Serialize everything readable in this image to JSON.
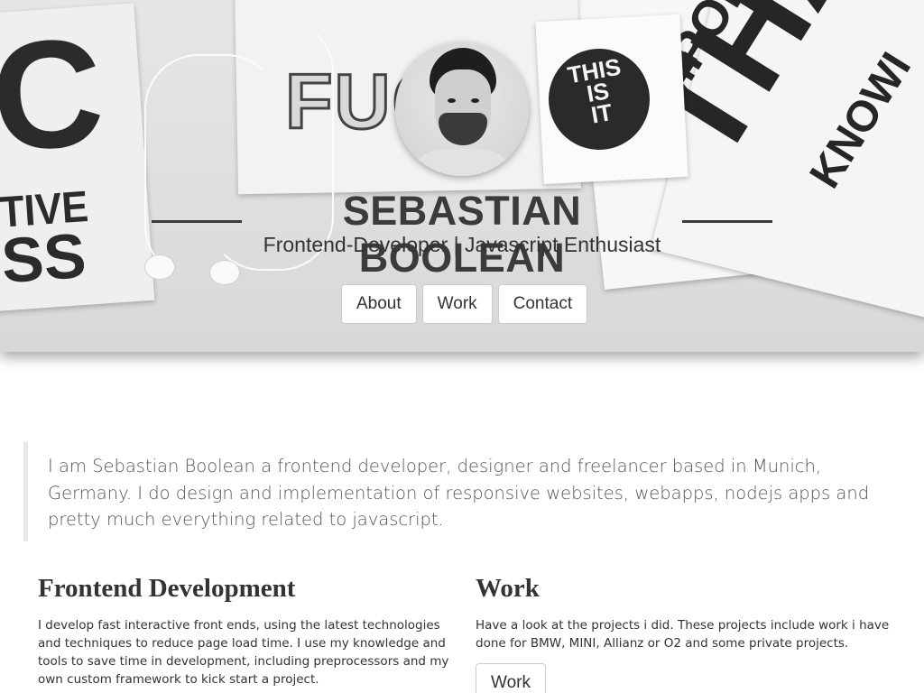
{
  "hero": {
    "name": "SEBASTIAN BOOLEAN",
    "tagline": "Frontend-Developer | Javascript Enthusiast",
    "nav": [
      "About",
      "Work",
      "Contact"
    ],
    "decor": {
      "big_c": "C",
      "tive": "TIVE",
      "ss": "SS",
      "floral": "FUC",
      "this_is_it": [
        "THIS",
        "IS",
        "IT"
      ],
      "tha": "THA",
      "impor": "IMPOR",
      "know": "KNOWI"
    }
  },
  "intro": {
    "text": "I am Sebastian Boolean a frontend developer, designer and freelancer based in Munich, Germany. I do design and implementation of responsive websites, webapps, nodejs apps and pretty much everything related to javascript."
  },
  "sections": {
    "frontend": {
      "title": "Frontend Development",
      "text": "I develop fast interactive front ends, using the latest technologies and techniques to reduce page load time. I use my knowledge and tools to save time in development, including preprocessors and my own custom framework to kick start a project."
    },
    "work": {
      "title": "Work",
      "text": "Have a look at the projects i did. These projects include work i have done for BMW, MINI, Allianz or O2 and some private projects.",
      "button": "Work"
    }
  }
}
